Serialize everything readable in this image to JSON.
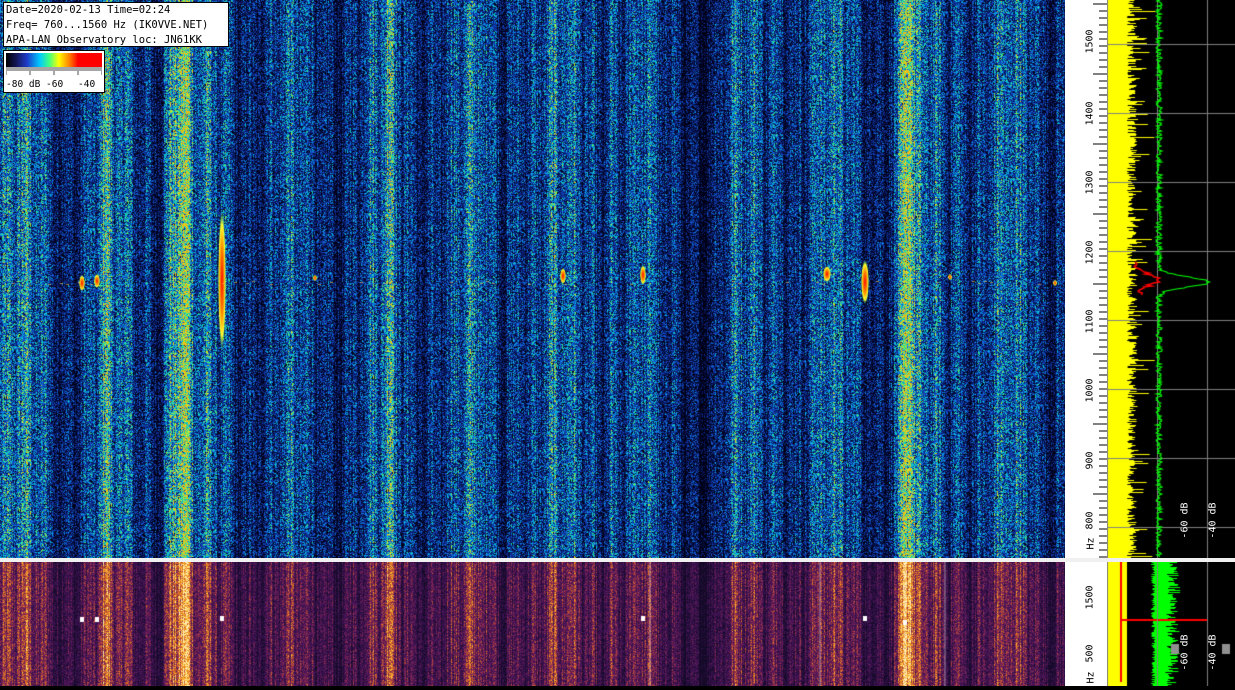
{
  "info": {
    "line1": "Date=2020-02-13 Time=02:24",
    "line2": "Freq= 760...1560 Hz (IK0VVE.NET)",
    "line3": "APA-LAN Observatory loc: JN61KK"
  },
  "colorbar": {
    "label_low": "-80 dB",
    "label_mid": "-60",
    "label_high": "-40"
  },
  "freq_scale": {
    "ticks": [
      "1500",
      "1400",
      "1300",
      "1200",
      "1100",
      "1000",
      "900",
      "800"
    ],
    "unit": "Hz"
  },
  "lower_scale": {
    "tick_high": "1500",
    "tick_low": "500",
    "unit": "Hz"
  },
  "power_panel": {
    "label_a": "-60 dB",
    "label_b": "-40 dB"
  },
  "colors": {
    "trace_yellow": "#ffff00",
    "trace_green": "#00ff00",
    "trace_red": "#ff0000"
  }
}
